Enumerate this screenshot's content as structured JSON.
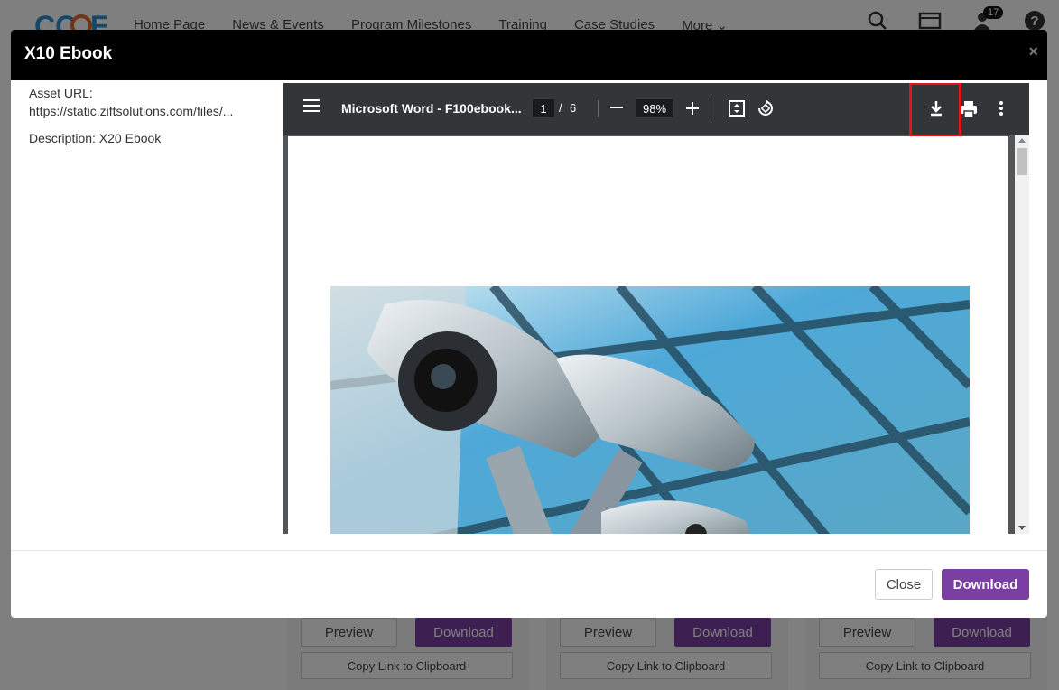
{
  "background": {
    "nav": {
      "items": [
        "Home Page",
        "News & Events",
        "Program Milestones",
        "Training",
        "Case Studies",
        "More"
      ],
      "notification_count": "17"
    },
    "cards": [
      {
        "preview": "Preview",
        "download": "Download",
        "copy": "Copy Link to Clipboard"
      },
      {
        "preview": "Preview",
        "download": "Download",
        "copy": "Copy Link to Clipboard"
      },
      {
        "preview": "Preview",
        "download": "Download",
        "copy": "Copy Link to Clipboard"
      }
    ]
  },
  "modal": {
    "title": "X10 Ebook",
    "close_icon": "×",
    "asset_url_label": "Asset URL:",
    "asset_url_value": "https://static.ziftsolutions.com/files/...",
    "description": "Description: X20 Ebook",
    "pdf": {
      "doc_title": "Microsoft Word - F100ebook...",
      "current_page": "1",
      "separator": "/",
      "total_pages": "6",
      "zoom": "98%"
    },
    "footer": {
      "close_label": "Close",
      "download_label": "Download"
    }
  },
  "colors": {
    "accent": "#7b3fa4",
    "highlight": "#e3151b",
    "toolbar": "#323639"
  }
}
